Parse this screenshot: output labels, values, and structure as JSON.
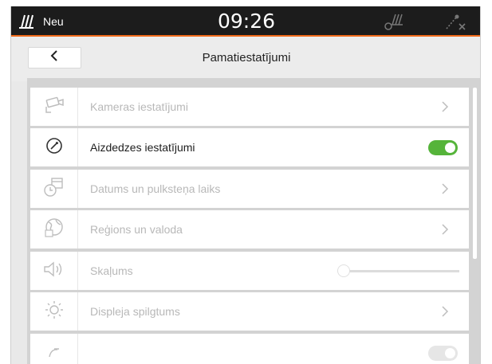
{
  "status": {
    "text": "Neu",
    "time": "09:26"
  },
  "header": {
    "title": "Pamatiestatījumi"
  },
  "colors": {
    "accent": "#f06a1a",
    "toggle_on": "#55b43a",
    "statusbar": "#1c1c1c"
  },
  "settings": {
    "items": [
      {
        "label": "Kameras iestatījumi",
        "icon": "camera-icon",
        "control": "chevron",
        "enabled": false
      },
      {
        "label": "Aizdedzes iestatījumi",
        "icon": "ignition-icon",
        "control": "toggle",
        "toggle_on": true,
        "enabled": true
      },
      {
        "label": "Datums un pulksteņa laiks",
        "icon": "calendar-clock-icon",
        "control": "chevron",
        "enabled": false
      },
      {
        "label": "Reģions un valoda",
        "icon": "globe-icon",
        "control": "chevron",
        "enabled": false
      },
      {
        "label": "Skaļums",
        "icon": "speaker-icon",
        "control": "slider",
        "slider_value": 0,
        "enabled": false
      },
      {
        "label": "Displeja spilgtums",
        "icon": "sun-icon",
        "control": "chevron",
        "enabled": false
      },
      {
        "label": "",
        "icon": "partial-icon",
        "control": "toggle",
        "toggle_on": false,
        "enabled": false
      }
    ]
  }
}
